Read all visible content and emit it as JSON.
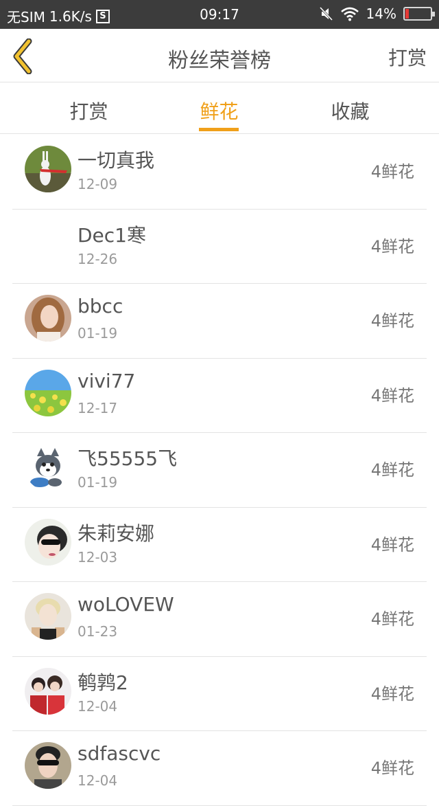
{
  "status_bar": {
    "carrier": "无SIM",
    "speed": "1.6K/s",
    "sim_glyph": "S",
    "time": "09:17",
    "battery": "14%",
    "battery_level": 0.14
  },
  "header": {
    "title": "粉丝荣誉榜",
    "action": "打赏"
  },
  "tabs": [
    {
      "label": "打赏",
      "active": false
    },
    {
      "label": "鲜花",
      "active": true
    },
    {
      "label": "收藏",
      "active": false
    }
  ],
  "accent": "#f0a01a",
  "fans": [
    {
      "name": "一切真我",
      "date": "12-09",
      "count": "4鲜花",
      "avatar": "rabbit-photo"
    },
    {
      "name": "Dec1寒",
      "date": "12-26",
      "count": "4鲜花",
      "avatar": "none"
    },
    {
      "name": "bbcc",
      "date": "01-19",
      "count": "4鲜花",
      "avatar": "woman-photo"
    },
    {
      "name": "vivi77",
      "date": "12-17",
      "count": "4鲜花",
      "avatar": "flower-field-photo"
    },
    {
      "name": "飞55555飞",
      "date": "01-19",
      "count": "4鲜花",
      "avatar": "husky-cartoon"
    },
    {
      "name": "朱莉安娜",
      "date": "12-03",
      "count": "4鲜花",
      "avatar": "sunglasses-photo"
    },
    {
      "name": "woLOVEW",
      "date": "01-23",
      "count": "4鲜花",
      "avatar": "blond-person-photo"
    },
    {
      "name": "鹌鹑2",
      "date": "12-04",
      "count": "4鲜花",
      "avatar": "couple-photo"
    },
    {
      "name": "sdfascvc",
      "date": "12-04",
      "count": "4鲜花",
      "avatar": "man-sunglasses-photo"
    }
  ]
}
